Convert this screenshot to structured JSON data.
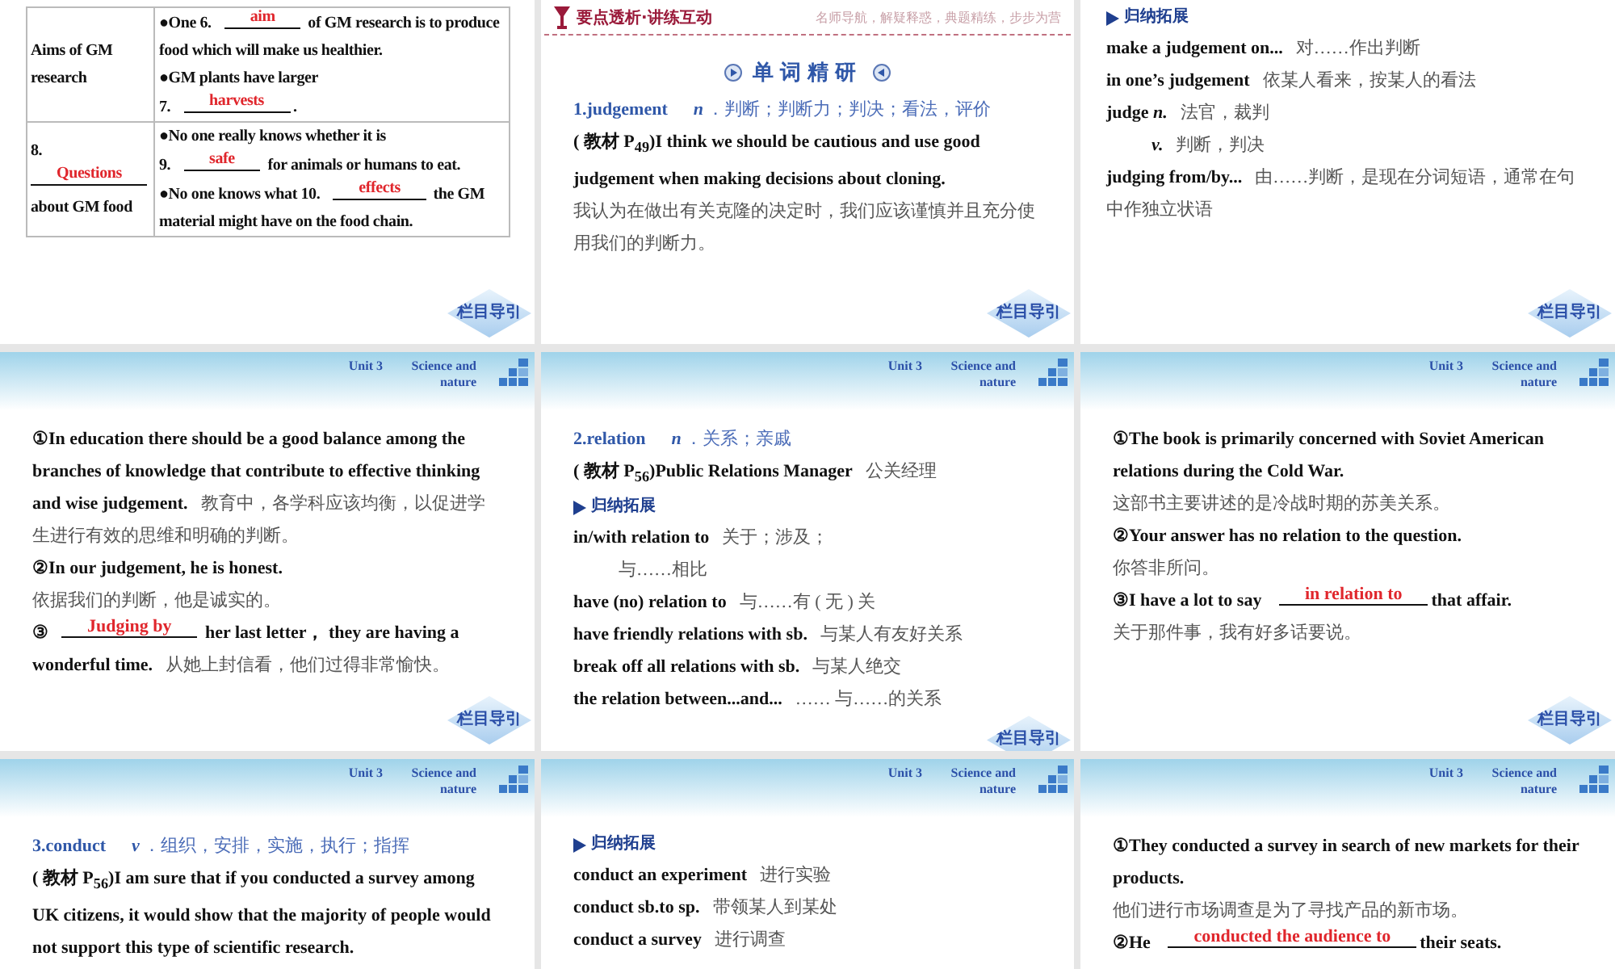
{
  "slides": [
    {
      "blocks": [
        {
          "kind": "table",
          "rows": [
            {
              "label": [
                {
                  "kind": "en",
                  "text": "Aims of GM research"
                }
              ],
              "content": [
                [
                  {
                    "kind": "en",
                    "text": "●One 6."
                  },
                  {
                    "kind": "blank",
                    "text": "aim"
                  },
                  {
                    "kind": "en",
                    "text": " of GM research is to produce food which will make us healthier."
                  }
                ],
                [
                  {
                    "kind": "en",
                    "text": "●GM plants have larger"
                  }
                ],
                [
                  {
                    "kind": "en",
                    "text": "7."
                  },
                  {
                    "kind": "blank",
                    "text": "harvests"
                  },
                  {
                    "kind": "en",
                    "text": "."
                  }
                ]
              ]
            },
            {
              "label": [
                {
                  "kind": "en",
                  "text": "8."
                },
                {
                  "kind": "blank",
                  "text": "Questions"
                },
                {
                  "kind": "en",
                  "text": " about GM food"
                }
              ],
              "content": [
                [
                  {
                    "kind": "en",
                    "text": "●No one really knows whether it is"
                  }
                ],
                [
                  {
                    "kind": "en",
                    "text": "9."
                  },
                  {
                    "kind": "blank",
                    "text": "safe"
                  },
                  {
                    "kind": "en",
                    "text": " for animals or humans to eat."
                  }
                ],
                [
                  {
                    "kind": "en",
                    "text": "●No one knows what 10."
                  },
                  {
                    "kind": "blank",
                    "text": "effects"
                  },
                  {
                    "kind": "en",
                    "text": " the GM material might have on the food chain."
                  }
                ]
              ]
            }
          ]
        }
      ],
      "nav": "栏目导引"
    },
    {
      "header": {
        "kind": "banner",
        "title": "要点透析·讲练互动",
        "tagline": "名师导航，解疑释惑，典题精练，步步为营"
      },
      "blocks": [
        {
          "kind": "word_heading",
          "text": "单词精研"
        },
        {
          "kind": "line",
          "segments": [
            {
              "kind": "head",
              "text": "1.judgement"
            },
            {
              "kind": "pos",
              "text": "n"
            },
            {
              "kind": "gloss",
              "text": "．判断；判断力；判决；看法，评价"
            }
          ]
        },
        {
          "kind": "line",
          "segments": [
            {
              "kind": "en",
              "text": "( 教材 P$_{49}$)I think we should be cautious and use good judgement when making decisions about cloning."
            }
          ]
        },
        {
          "kind": "line",
          "segments": [
            {
              "kind": "zh",
              "text": "我认为在做出有关克隆的决定时，我们应该谨慎并且充分使用我们的判断力。"
            }
          ]
        }
      ],
      "nav": "栏目导引"
    },
    {
      "blocks": [
        {
          "kind": "section",
          "text": "归纳拓展"
        },
        {
          "kind": "line",
          "segments": [
            {
              "kind": "en",
              "text": "make a judgement on..."
            },
            {
              "kind": "zh",
              "text": "对……作出判断"
            }
          ]
        },
        {
          "kind": "line",
          "segments": [
            {
              "kind": "en",
              "text": "in one’s judgement"
            },
            {
              "kind": "zh",
              "text": "依某人看来，按某人的看法"
            }
          ]
        },
        {
          "kind": "line",
          "segments": [
            {
              "kind": "en",
              "text": "judge *n.*"
            },
            {
              "kind": "zh",
              "text": "法官，裁判"
            }
          ]
        },
        {
          "kind": "indented",
          "segments": [
            {
              "kind": "en",
              "text": "*v.*"
            },
            {
              "kind": "zh",
              "text": "判断，判决"
            }
          ]
        },
        {
          "kind": "line",
          "segments": [
            {
              "kind": "en",
              "text": "judging from/by..."
            },
            {
              "kind": "zh",
              "text": "由……判断，是现在分词短语，通常在句中作独立状语"
            }
          ]
        }
      ],
      "nav": "栏目导引"
    },
    {
      "header": {
        "kind": "unit",
        "unit": "Unit 3",
        "title": "Science and nature"
      },
      "blocks": [
        {
          "kind": "line",
          "segments": [
            {
              "kind": "en",
              "text": "①In education there should be a good balance among the branches of knowledge that contribute to effective thinking and wise judgement."
            },
            {
              "kind": "zh",
              "text": "教育中，各学科应该均衡，以促进学生进行有效的思维和明确的判断。"
            }
          ]
        },
        {
          "kind": "line",
          "segments": [
            {
              "kind": "en",
              "text": "②In our judgement, he is honest."
            }
          ]
        },
        {
          "kind": "line",
          "segments": [
            {
              "kind": "zh",
              "text": "依据我们的判断，他是诚实的。"
            }
          ]
        },
        {
          "kind": "line",
          "segments": [
            {
              "kind": "en",
              "text": "③"
            },
            {
              "kind": "blank",
              "text": "Judging by"
            },
            {
              "kind": "en",
              "text": " her last letter， they are having a wonderful time."
            },
            {
              "kind": "zh",
              "text": "从她上封信看，他们过得非常愉快。"
            }
          ]
        }
      ],
      "nav": "栏目导引"
    },
    {
      "header": {
        "kind": "unit",
        "unit": "Unit 3",
        "title": "Science and nature"
      },
      "blocks": [
        {
          "kind": "line",
          "segments": [
            {
              "kind": "head",
              "text": "2.relation"
            },
            {
              "kind": "pos",
              "text": "n"
            },
            {
              "kind": "gloss",
              "text": "．关系；亲戚"
            }
          ]
        },
        {
          "kind": "line",
          "segments": [
            {
              "kind": "en",
              "text": "( 教材 P$_{56}$)Public Relations Manager"
            },
            {
              "kind": "zh",
              "text": "公关经理"
            }
          ]
        },
        {
          "kind": "section",
          "text": "归纳拓展"
        },
        {
          "kind": "line",
          "segments": [
            {
              "kind": "en",
              "text": "in/with relation to"
            },
            {
              "kind": "zh",
              "text": "关于；涉及；"
            }
          ]
        },
        {
          "kind": "indented",
          "segments": [
            {
              "kind": "zh",
              "text": "与……相比"
            }
          ]
        },
        {
          "kind": "line",
          "segments": [
            {
              "kind": "en",
              "text": "have (no) relation to"
            },
            {
              "kind": "zh",
              "text": "与……有 ( 无 ) 关"
            }
          ]
        },
        {
          "kind": "line",
          "segments": [
            {
              "kind": "en",
              "text": "have friendly relations with sb."
            },
            {
              "kind": "zh",
              "text": "与某人有友好关系"
            }
          ]
        },
        {
          "kind": "line",
          "segments": [
            {
              "kind": "en",
              "text": "break off all relations with sb."
            },
            {
              "kind": "zh",
              "text": "与某人绝交"
            }
          ]
        },
        {
          "kind": "line",
          "segments": [
            {
              "kind": "en",
              "text": "the relation between...and..."
            },
            {
              "kind": "zh",
              "text": "…… 与……的关系"
            }
          ]
        }
      ],
      "nav": "栏目导引"
    },
    {
      "header": {
        "kind": "unit",
        "unit": "Unit 3",
        "title": "Science and nature"
      },
      "blocks": [
        {
          "kind": "line",
          "segments": [
            {
              "kind": "en",
              "text": "①The book is primarily concerned with Soviet American relations during the Cold War."
            }
          ]
        },
        {
          "kind": "line",
          "segments": [
            {
              "kind": "zh",
              "text": "这部书主要讲述的是冷战时期的苏美关系。"
            }
          ]
        },
        {
          "kind": "line",
          "segments": [
            {
              "kind": "en",
              "text": "②Your answer has no relation to the question."
            }
          ]
        },
        {
          "kind": "line",
          "segments": [
            {
              "kind": "zh",
              "text": "你答非所问。"
            }
          ]
        },
        {
          "kind": "line",
          "segments": [
            {
              "kind": "en",
              "text": "③I have a lot to say "
            },
            {
              "kind": "blank",
              "text": "in relation to"
            },
            {
              "kind": "en",
              "text": "that affair."
            }
          ]
        },
        {
          "kind": "line",
          "segments": [
            {
              "kind": "zh",
              "text": "关于那件事，我有好多话要说。"
            }
          ]
        }
      ],
      "nav": "栏目导引"
    },
    {
      "header": {
        "kind": "unit",
        "unit": "Unit 3",
        "title": "Science and nature"
      },
      "blocks": [
        {
          "kind": "line",
          "segments": [
            {
              "kind": "head",
              "text": "3.conduct"
            },
            {
              "kind": "pos",
              "text": "v"
            },
            {
              "kind": "gloss",
              "text": "．组织，安排，实施，执行；指挥"
            }
          ]
        },
        {
          "kind": "line",
          "segments": [
            {
              "kind": "en",
              "text": "( 教材 P$_{56}$)I am sure that if you conducted a survey among UK citizens, it would show that the majority of people would not support this type of scientific research."
            }
          ]
        }
      ]
    },
    {
      "header": {
        "kind": "unit",
        "unit": "Unit 3",
        "title": "Science and nature"
      },
      "blocks": [
        {
          "kind": "section",
          "text": "归纳拓展"
        },
        {
          "kind": "line",
          "segments": [
            {
              "kind": "en",
              "text": "conduct an experiment"
            },
            {
              "kind": "zh",
              "text": "进行实验"
            }
          ]
        },
        {
          "kind": "line",
          "segments": [
            {
              "kind": "en",
              "text": "conduct sb.to sp."
            },
            {
              "kind": "zh",
              "text": "带领某人到某处"
            }
          ]
        },
        {
          "kind": "line",
          "segments": [
            {
              "kind": "en",
              "text": "conduct a survey"
            },
            {
              "kind": "zh",
              "text": "进行调查"
            }
          ]
        }
      ]
    },
    {
      "header": {
        "kind": "unit",
        "unit": "Unit 3",
        "title": "Science and nature"
      },
      "blocks": [
        {
          "kind": "line",
          "segments": [
            {
              "kind": "en",
              "text": "①They conducted a survey in search of new markets for their products."
            }
          ]
        },
        {
          "kind": "line",
          "segments": [
            {
              "kind": "zh",
              "text": "他们进行市场调查是为了寻找产品的新市场。"
            }
          ]
        },
        {
          "kind": "line",
          "segments": [
            {
              "kind": "en",
              "text": "②He "
            },
            {
              "kind": "blank",
              "text": "conducted the audience to"
            },
            {
              "kind": "en",
              "text": "their seats."
            }
          ]
        }
      ]
    }
  ]
}
